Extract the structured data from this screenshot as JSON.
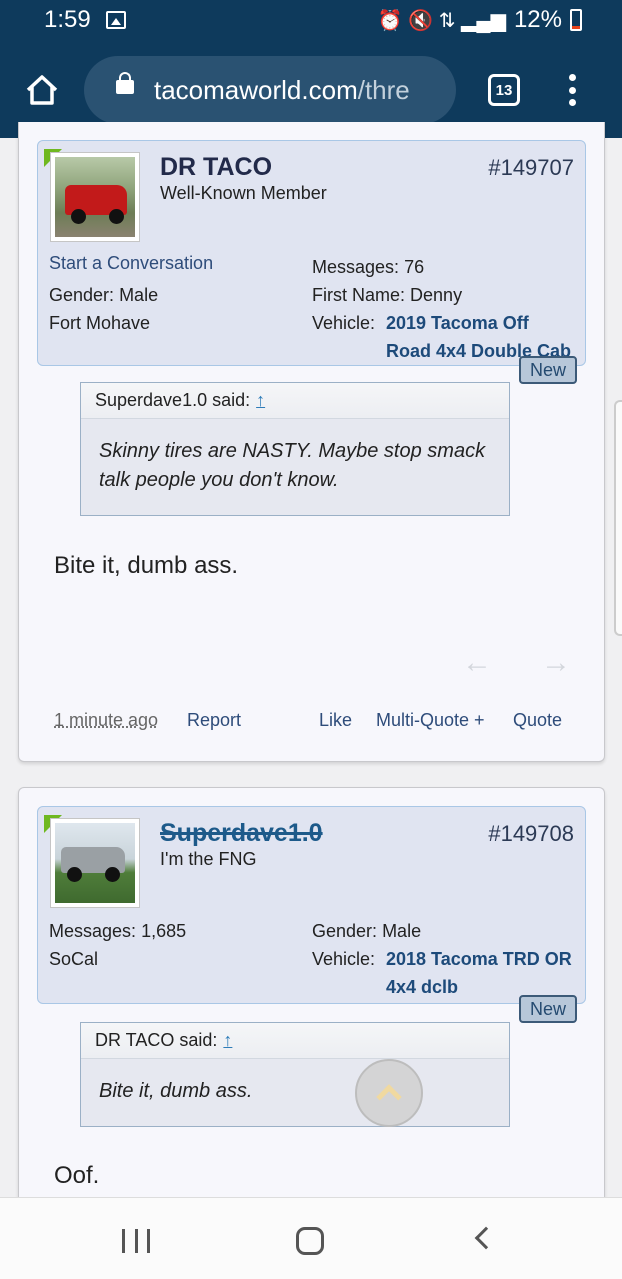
{
  "status_bar": {
    "time": "1:59",
    "battery": "12%",
    "right_glyphs": "⏰ 🔇 ⇅ ▂▄▆"
  },
  "browser": {
    "url_host": "tacomaworld.com",
    "url_path": "/thre",
    "tab_count": "13"
  },
  "posts": [
    {
      "username": "DR TACO",
      "user_title": "Well-Known Member",
      "post_number": "#149707",
      "start_conversation": "Start a Conversation",
      "gender_label": "Gender:",
      "gender_value": "Male",
      "location": "Fort Mohave",
      "messages_label": "Messages:",
      "messages_value": "76",
      "first_name_label": "First Name:",
      "first_name_value": "Denny",
      "vehicle_label": "Vehicle:",
      "vehicle_value": "2019 Tacoma Off Road 4x4 Double Cab",
      "new_badge": "New",
      "quote_author": "Superdave1.0 said:",
      "quote_text": "Skinny tires are NASTY. Maybe stop smack talk people you don't know.",
      "message": "Bite it, dumb ass.",
      "timestamp": "1 minute ago",
      "report": "Report",
      "like": "Like",
      "multi_quote": "Multi-Quote +",
      "quote": "Quote"
    },
    {
      "username": "Superdave1.0",
      "user_title": "I'm the FNG",
      "post_number": "#149708",
      "messages_label": "Messages:",
      "messages_value": "1,685",
      "location": "SoCal",
      "gender_label": "Gender:",
      "gender_value": "Male",
      "vehicle_label": "Vehicle:",
      "vehicle_value": "2018 Tacoma TRD OR 4x4 dclb",
      "new_badge": "New",
      "quote_author": "DR TACO said:",
      "quote_text": "Bite it, dumb ass.",
      "message": "Oof."
    }
  ],
  "nav_arrows": {
    "prev": "←",
    "next": "→"
  },
  "colors": {
    "top_bar": "#0e3a5c",
    "user_block": "#e0e4f1",
    "link": "#2e4c7a",
    "online_marker": "#6fb820"
  }
}
